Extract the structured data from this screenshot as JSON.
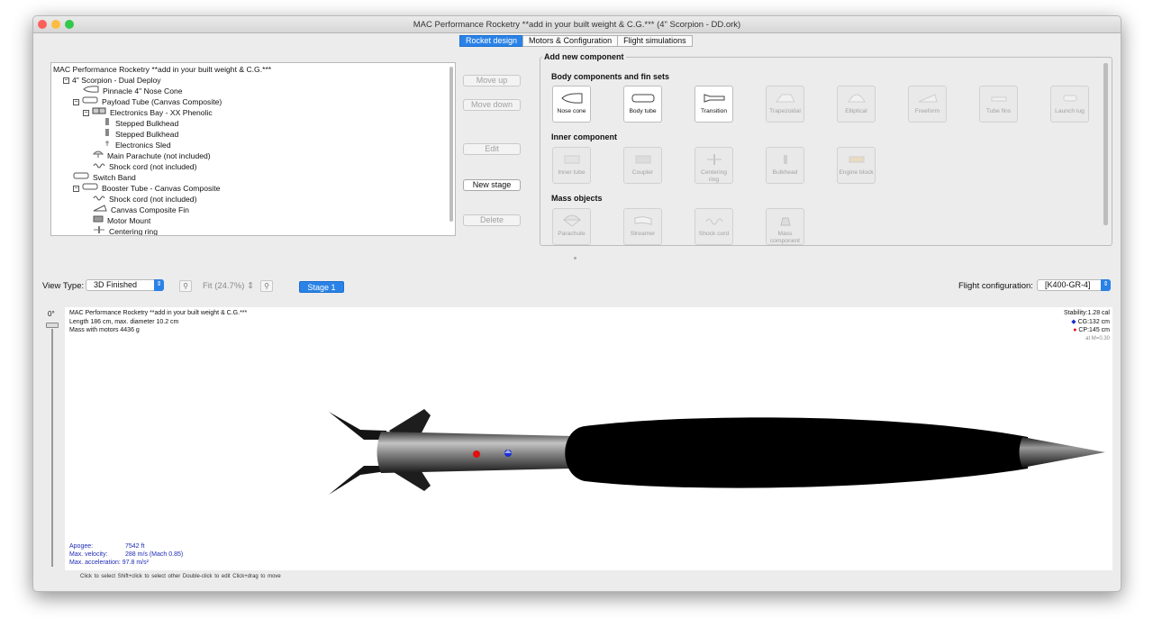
{
  "window": {
    "title": "MAC Performance Rocketry **add in your built weight & C.G.*** (4\" Scorpion - DD.ork)"
  },
  "tabs": [
    {
      "label": "Rocket design",
      "active": true
    },
    {
      "label": "Motors & Configuration",
      "active": false
    },
    {
      "label": "Flight simulations",
      "active": false
    }
  ],
  "tree": {
    "rows": [
      {
        "label": "MAC Performance Rocketry **add in your built weight & C.G.***",
        "depth": 0,
        "expand": "",
        "icon": ""
      },
      {
        "label": "4\" Scorpion - Dual Deploy",
        "depth": 1,
        "expand": "⊟",
        "icon": ""
      },
      {
        "label": "Pinnacle 4\" Nose Cone",
        "depth": 3,
        "expand": "",
        "icon": "nose-cone"
      },
      {
        "label": "Payload Tube (Canvas Composite)",
        "depth": 2,
        "expand": "⊟",
        "icon": "tube"
      },
      {
        "label": "Electronics Bay - XX Phenolic",
        "depth": 3,
        "expand": "⊟",
        "icon": "bay"
      },
      {
        "label": "Stepped Bulkhead",
        "depth": 5,
        "expand": "",
        "icon": "bulkhead"
      },
      {
        "label": "Stepped Bulkhead",
        "depth": 5,
        "expand": "",
        "icon": "bulkhead"
      },
      {
        "label": "Electronics Sled",
        "depth": 5,
        "expand": "",
        "icon": "sled"
      },
      {
        "label": "Main Parachute (not included)",
        "depth": 4,
        "expand": "",
        "icon": "parachute"
      },
      {
        "label": "Shock cord (not included)",
        "depth": 4,
        "expand": "",
        "icon": "shock"
      },
      {
        "label": "Switch Band",
        "depth": 2,
        "expand": "",
        "icon": "tube"
      },
      {
        "label": "Booster Tube - Canvas Composite",
        "depth": 2,
        "expand": "⊟",
        "icon": "tube"
      },
      {
        "label": "Shock cord (not included)",
        "depth": 4,
        "expand": "",
        "icon": "shock"
      },
      {
        "label": "Canvas Composite Fin",
        "depth": 4,
        "expand": "",
        "icon": "fin"
      },
      {
        "label": "Motor Mount",
        "depth": 4,
        "expand": "",
        "icon": "motor"
      },
      {
        "label": "Centering ring",
        "depth": 4,
        "expand": "",
        "icon": "ring"
      }
    ]
  },
  "actions": {
    "move_up": "Move up",
    "move_down": "Move down",
    "edit": "Edit",
    "new_stage": "New stage",
    "delete": "Delete"
  },
  "add_panel": {
    "title": "Add new component",
    "body_section": "Body components and fin sets",
    "body": [
      {
        "label": "Nose cone",
        "enabled": true
      },
      {
        "label": "Body tube",
        "enabled": true
      },
      {
        "label": "Transition",
        "enabled": true
      },
      {
        "label": "Trapezoidal",
        "enabled": false
      },
      {
        "label": "Elliptical",
        "enabled": false
      },
      {
        "label": "Freeform",
        "enabled": false
      },
      {
        "label": "Tube fins",
        "enabled": false
      },
      {
        "label": "Launch lug",
        "enabled": false
      }
    ],
    "inner_section": "Inner component",
    "inner": [
      {
        "label": "Inner tube"
      },
      {
        "label": "Coupler"
      },
      {
        "label": "Centering ring"
      },
      {
        "label": "Bulkhead"
      },
      {
        "label": "Engine block"
      }
    ],
    "mass_section": "Mass objects",
    "mass": [
      {
        "label": "Parachute"
      },
      {
        "label": "Streamer"
      },
      {
        "label": "Shock cord"
      },
      {
        "label": "Mass component"
      }
    ]
  },
  "view": {
    "view_type_label": "View Type:",
    "view_type_value": "3D Finished",
    "zoom_value": "Fit (24.7%)",
    "stage_label": "Stage 1",
    "flight_config_label": "Flight configuration:",
    "flight_config_value": "[K400-GR-4]",
    "rotation": "0°"
  },
  "figure": {
    "info_title": "MAC Performance Rocketry **add in your built weight & C.G.***",
    "info_length": "Length 186 cm, max. diameter 10.2 cm",
    "info_mass": "Mass with motors 4436 g",
    "stability": "Stability:1.28 cal",
    "cg": "CG:132 cm",
    "cp": "CP:145 cm",
    "mach": "at M=0.30",
    "apogee_label": "Apogee:",
    "apogee_value": "7542 ft",
    "velocity_label": "Max. velocity:",
    "velocity_value": "288 m/s  (Mach 0.85)",
    "accel_label": "Max. acceleration:",
    "accel_value": "97.8 m/s²"
  },
  "hint": "Click to select    Shift+click to select other    Double-click to edit    Click+drag to move",
  "colors": {
    "accent": "#2a82e6",
    "cp_marker": "#e01010",
    "cg_marker": "#1a2fd0"
  }
}
